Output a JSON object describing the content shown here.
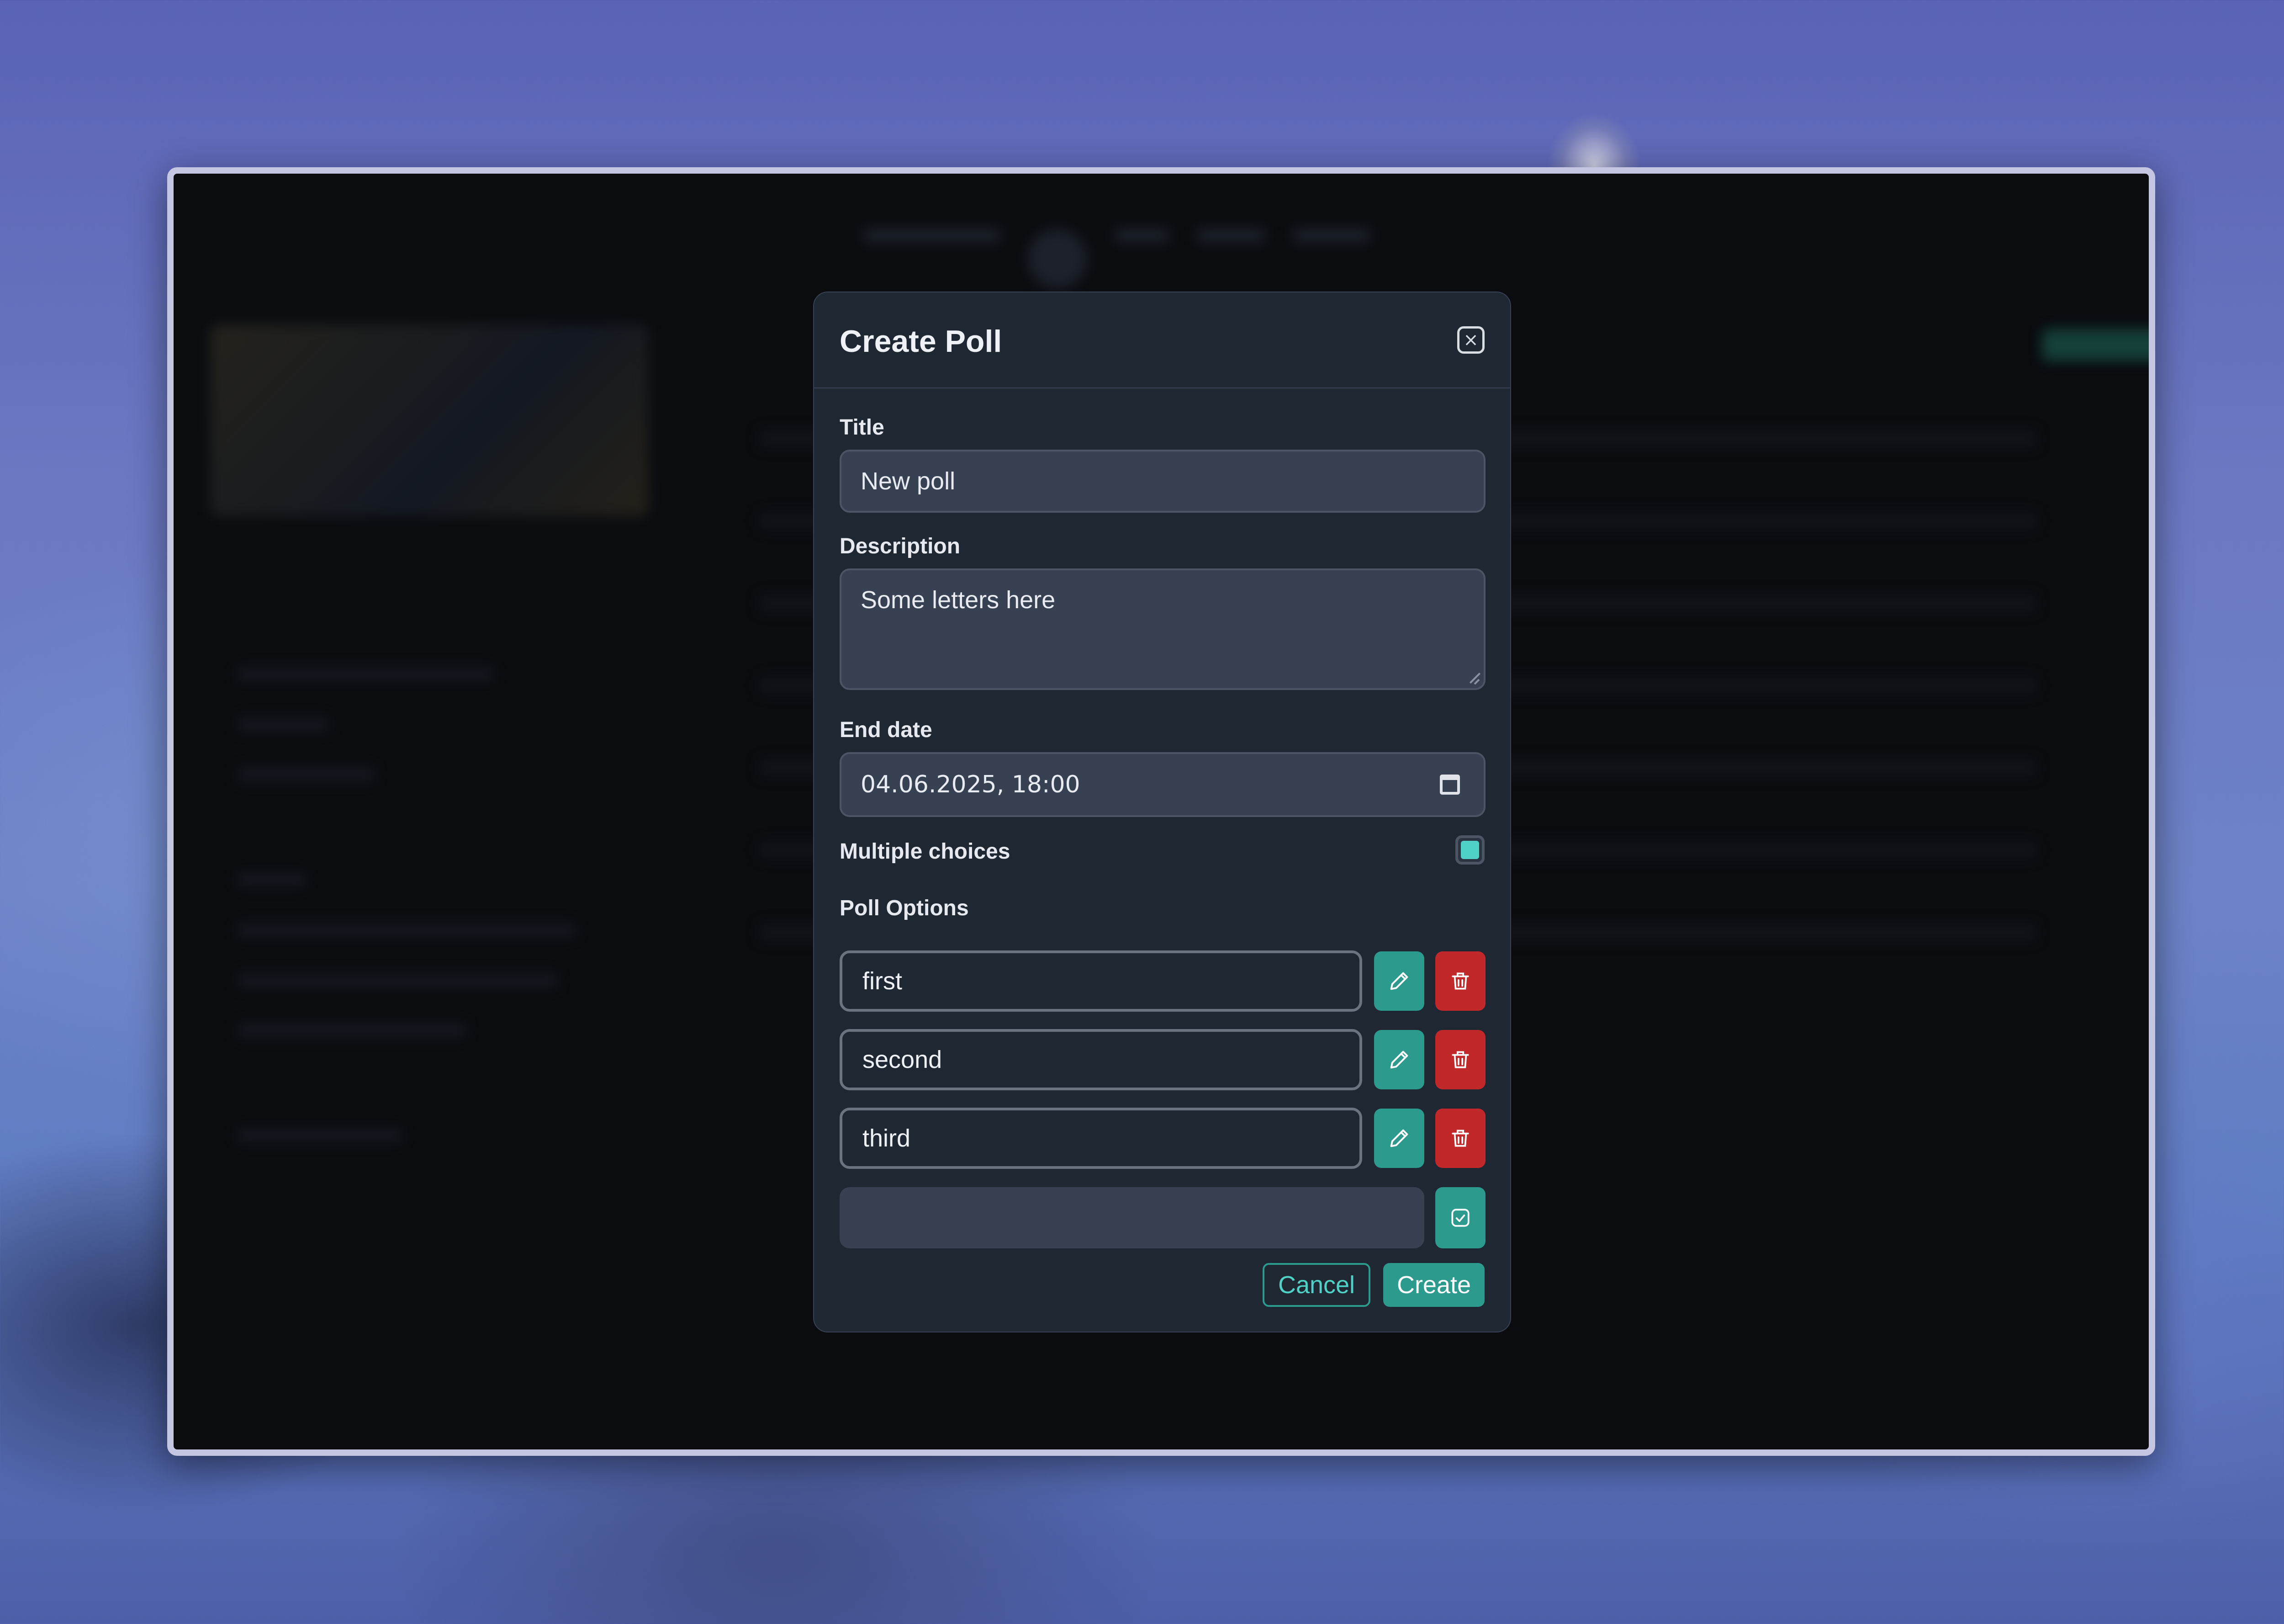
{
  "modal": {
    "title": "Create Poll",
    "close_icon": "close-icon"
  },
  "form": {
    "title_label": "Title",
    "title_value": "New poll",
    "description_label": "Description",
    "description_value": "Some letters here",
    "end_date_label": "End date",
    "end_date_value": "04.06.2025, 18:00",
    "calendar_icon": "calendar-icon",
    "multiple_choices_label": "Multiple choices",
    "multiple_choices_checked": true,
    "poll_options_label": "Poll Options",
    "options": [
      {
        "value": "first"
      },
      {
        "value": "second"
      },
      {
        "value": "third"
      }
    ],
    "new_option_value": ""
  },
  "icons": {
    "edit": "pencil-icon",
    "delete": "trash-icon",
    "confirm": "check-square-icon"
  },
  "actions": {
    "cancel_label": "Cancel",
    "create_label": "Create"
  },
  "colors": {
    "accent": "#2c9a8c",
    "accent_light": "#4fd1c5",
    "danger": "#c0282a",
    "modal_bg": "#1f2733",
    "input_bg": "#374151"
  }
}
